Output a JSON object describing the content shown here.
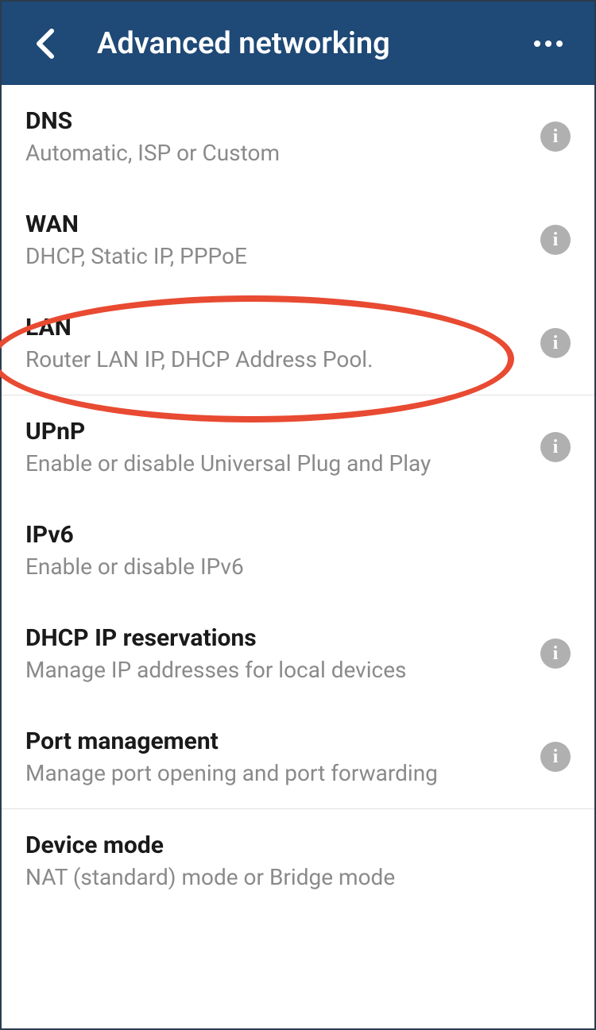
{
  "header": {
    "title": "Advanced networking"
  },
  "items": [
    {
      "id": "dns",
      "title": "DNS",
      "subtitle": "Automatic, ISP or Custom",
      "has_info": true
    },
    {
      "id": "wan",
      "title": "WAN",
      "subtitle": "DHCP, Static IP, PPPoE",
      "has_info": true
    },
    {
      "id": "lan",
      "title": "LAN",
      "subtitle": "Router LAN IP, DHCP Address Pool.",
      "has_info": true,
      "highlighted": true
    },
    {
      "id": "upnp",
      "title": "UPnP",
      "subtitle": "Enable or disable Universal Plug and Play",
      "has_info": true
    },
    {
      "id": "ipv6",
      "title": "IPv6",
      "subtitle": "Enable or disable IPv6",
      "has_info": false
    },
    {
      "id": "dhcp-reservations",
      "title": "DHCP IP reservations",
      "subtitle": "Manage IP addresses for local devices",
      "has_info": true
    },
    {
      "id": "port-management",
      "title": "Port management",
      "subtitle": "Manage port opening and port forwarding",
      "has_info": true
    },
    {
      "id": "device-mode",
      "title": "Device mode",
      "subtitle": "NAT (standard) mode or Bridge mode",
      "has_info": false
    }
  ],
  "annotation": {
    "highlight_color": "#e84a32"
  }
}
